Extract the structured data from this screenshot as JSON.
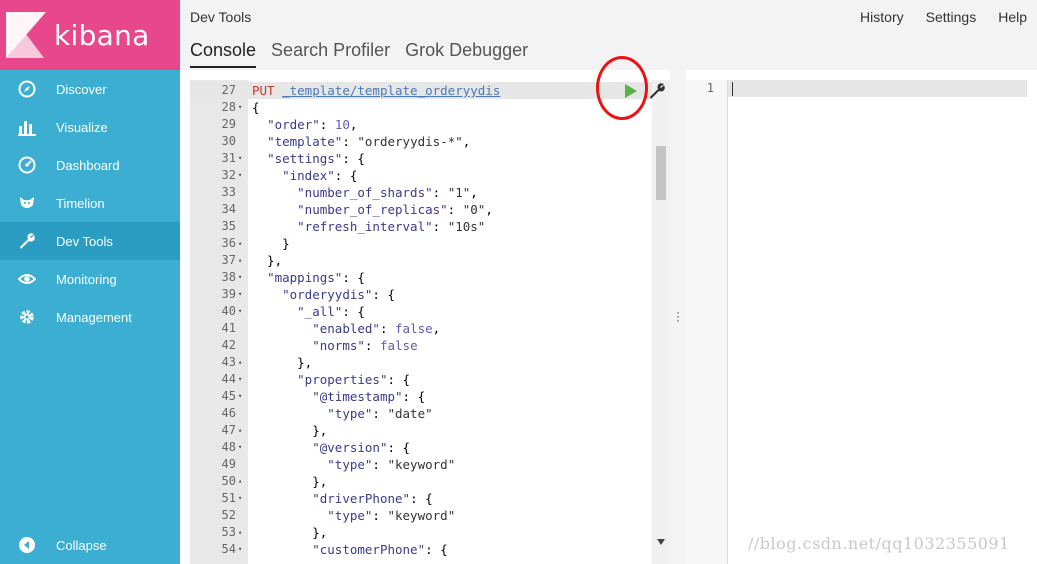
{
  "brand": {
    "name": "kibana",
    "logo_color": "#e8488b"
  },
  "sidebar": {
    "items": [
      {
        "label": "Discover",
        "icon": "compass-icon"
      },
      {
        "label": "Visualize",
        "icon": "bar-chart-icon"
      },
      {
        "label": "Dashboard",
        "icon": "dashboard-icon"
      },
      {
        "label": "Timelion",
        "icon": "timelion-icon"
      },
      {
        "label": "Dev Tools",
        "icon": "wrench-icon",
        "active": true
      },
      {
        "label": "Monitoring",
        "icon": "eye-icon"
      },
      {
        "label": "Management",
        "icon": "gear-icon"
      }
    ],
    "collapse_label": "Collapse",
    "bg_color": "#3caed2",
    "active_color": "#2b9cc2"
  },
  "header": {
    "title": "Dev Tools",
    "links": [
      "History",
      "Settings",
      "Help"
    ],
    "tabs": [
      {
        "label": "Console",
        "active": true
      },
      {
        "label": "Search Profiler"
      },
      {
        "label": "Grok Debugger"
      }
    ]
  },
  "editor": {
    "lines": [
      {
        "n": "27",
        "fold": "",
        "text": "PUT _template/template_orderyydis",
        "type": "request"
      },
      {
        "n": "28",
        "fold": "▾",
        "text": "{"
      },
      {
        "n": "29",
        "fold": "",
        "text": "  \"order\": 10,"
      },
      {
        "n": "30",
        "fold": "",
        "text": "  \"template\": \"orderyydis-*\","
      },
      {
        "n": "31",
        "fold": "▾",
        "text": "  \"settings\": {"
      },
      {
        "n": "32",
        "fold": "▾",
        "text": "    \"index\": {"
      },
      {
        "n": "33",
        "fold": "",
        "text": "      \"number_of_shards\": \"1\","
      },
      {
        "n": "34",
        "fold": "",
        "text": "      \"number_of_replicas\": \"0\","
      },
      {
        "n": "35",
        "fold": "",
        "text": "      \"refresh_interval\": \"10s\""
      },
      {
        "n": "36",
        "fold": "▴",
        "text": "    }"
      },
      {
        "n": "37",
        "fold": "▴",
        "text": "  },"
      },
      {
        "n": "38",
        "fold": "▾",
        "text": "  \"mappings\": {"
      },
      {
        "n": "39",
        "fold": "▾",
        "text": "    \"orderyydis\": {"
      },
      {
        "n": "40",
        "fold": "▾",
        "text": "      \"_all\": {"
      },
      {
        "n": "41",
        "fold": "",
        "text": "        \"enabled\": false,"
      },
      {
        "n": "42",
        "fold": "",
        "text": "        \"norms\": false"
      },
      {
        "n": "43",
        "fold": "▴",
        "text": "      },"
      },
      {
        "n": "44",
        "fold": "▾",
        "text": "      \"properties\": {"
      },
      {
        "n": "45",
        "fold": "▾",
        "text": "        \"@timestamp\": {"
      },
      {
        "n": "46",
        "fold": "",
        "text": "          \"type\": \"date\""
      },
      {
        "n": "47",
        "fold": "▴",
        "text": "        },"
      },
      {
        "n": "48",
        "fold": "▾",
        "text": "        \"@version\": {"
      },
      {
        "n": "49",
        "fold": "",
        "text": "          \"type\": \"keyword\""
      },
      {
        "n": "50",
        "fold": "▴",
        "text": "        },"
      },
      {
        "n": "51",
        "fold": "▾",
        "text": "        \"driverPhone\": {"
      },
      {
        "n": "52",
        "fold": "",
        "text": "          \"type\": \"keyword\""
      },
      {
        "n": "53",
        "fold": "▴",
        "text": "        },"
      },
      {
        "n": "54",
        "fold": "▾",
        "text": "        \"customerPhone\": {"
      }
    ]
  },
  "output": {
    "line_number": "1"
  },
  "watermark": "//blog.csdn.net/qq1032355091"
}
